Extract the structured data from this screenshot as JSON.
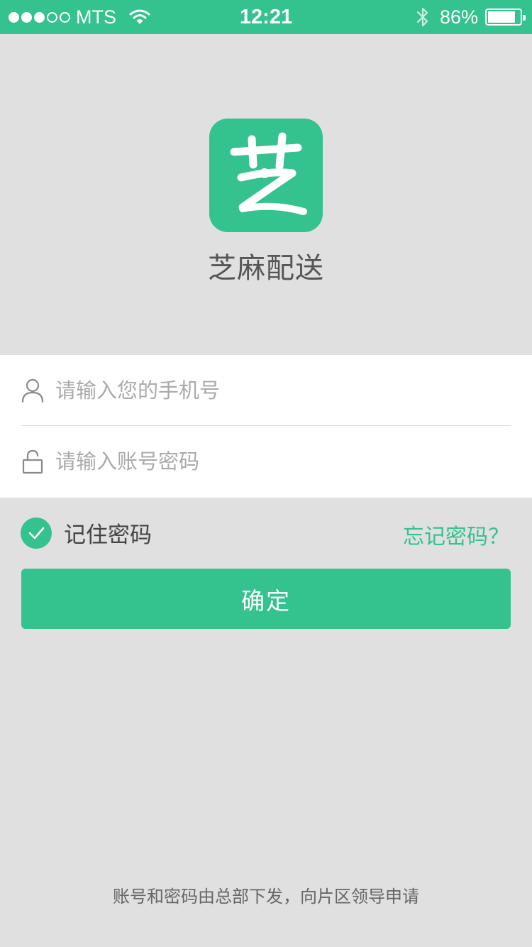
{
  "status_bar": {
    "carrier": "MTS",
    "time": "12:21",
    "battery_percent": "86%",
    "battery_level": 0.86,
    "signal_strength": 3,
    "signal_max": 5
  },
  "app": {
    "logo_glyph": "芝",
    "name": "芝麻配送"
  },
  "form": {
    "phone_placeholder": "请输入您的手机号",
    "phone_value": "",
    "password_placeholder": "请输入账号密码",
    "password_value": ""
  },
  "options": {
    "remember_label": "记住密码",
    "remember_checked": true,
    "forgot_label": "忘记密码？"
  },
  "actions": {
    "confirm_label": "确定"
  },
  "footer": {
    "note": "账号和密码由总部下发，向片区领导申请"
  },
  "colors": {
    "accent": "#34c28f",
    "background": "#e0e0e0",
    "panel": "#ffffff"
  },
  "icons": [
    "wifi-icon",
    "bluetooth-icon",
    "battery-icon",
    "user-icon",
    "lock-icon",
    "check-icon"
  ]
}
